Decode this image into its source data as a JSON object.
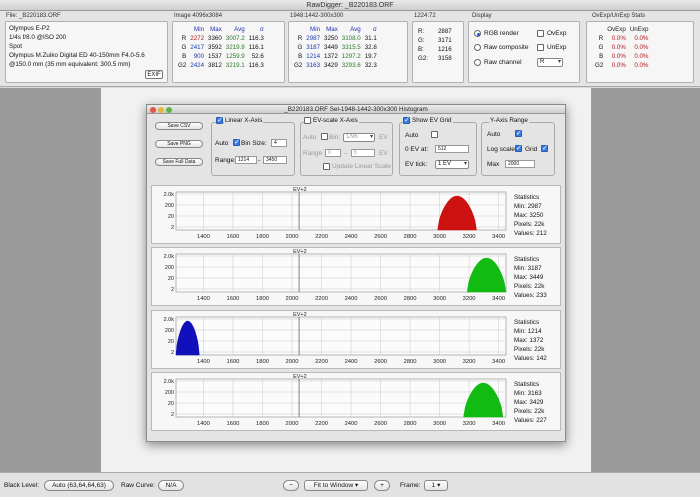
{
  "window": {
    "title": "RawDigger: _B220183.ORF"
  },
  "file_group": {
    "title": "File: _B220183.ORF",
    "lines": [
      "Olympus E-P2",
      "1/4s f/8.0 @ISO 200",
      "Spot",
      "Olympus M.Zuiko Digital ED 40-150mm F4.0-5.6",
      "@150.0 mm (35 mm equivalent: 300.5 mm)"
    ],
    "exif_label": "EXIF"
  },
  "image_group": {
    "title": "Image 4096x3084",
    "headers": [
      "Min",
      "Max",
      "Avg",
      "σ"
    ],
    "rows": [
      {
        "ch": "R",
        "min": "2272",
        "max": "3360",
        "avg": "3007.2",
        "sd": "116.3"
      },
      {
        "ch": "G",
        "min": "2417",
        "max": "3592",
        "avg": "3219.9",
        "sd": "116.1"
      },
      {
        "ch": "B",
        "min": "900",
        "max": "1537",
        "avg": "1259.9",
        "sd": "52.6"
      },
      {
        "ch": "G2",
        "min": "2424",
        "max": "3812",
        "avg": "3219.1",
        "sd": "116.3"
      }
    ]
  },
  "sel_group": {
    "title": "1948:1442-300x300",
    "headers": [
      "Min",
      "Max",
      "Avg",
      "σ"
    ],
    "rows": [
      {
        "ch": "R",
        "min": "2987",
        "max": "3250",
        "avg": "3108.0",
        "sd": "31.1"
      },
      {
        "ch": "G",
        "min": "3187",
        "max": "3449",
        "avg": "3315.5",
        "sd": "32.8"
      },
      {
        "ch": "B",
        "min": "1214",
        "max": "1372",
        "avg": "1297.2",
        "sd": "19.7"
      },
      {
        "ch": "G2",
        "min": "3163",
        "max": "3429",
        "avg": "3293.6",
        "sd": "32.3"
      }
    ]
  },
  "pixel_group": {
    "title": "1224:72",
    "rows": [
      {
        "ch": "R:",
        "val": "2887"
      },
      {
        "ch": "G:",
        "val": "3171"
      },
      {
        "ch": "B:",
        "val": "1216"
      },
      {
        "ch": "G2:",
        "val": "3158"
      }
    ]
  },
  "display_group": {
    "title": "Display",
    "rgb_render": "RGB render",
    "raw_composite": "Raw composite",
    "raw_channel": "Raw channel",
    "ovexp": "OvExp",
    "unexp": "UnExp",
    "channel_value": "R"
  },
  "ovexp_group": {
    "title": "OvExp/UnExp Stats",
    "headers": [
      "OvExp",
      "UnExp"
    ],
    "rows": [
      {
        "ch": "R",
        "ov": "0.0%",
        "un": "0.0%"
      },
      {
        "ch": "G",
        "ov": "0.0%",
        "un": "0.0%"
      },
      {
        "ch": "B",
        "ov": "0.0%",
        "un": "0.0%"
      },
      {
        "ch": "G2",
        "ov": "0.0%",
        "un": "0.0%"
      }
    ]
  },
  "hist_window": {
    "title": "_B220183.ORF Sel-1948-1442-300x300 Histogram",
    "buttons": {
      "save_csv": "Save CSV",
      "save_png": "Save PNG",
      "save_full": "Save Full Data"
    },
    "linear": {
      "title": "Linear X-Axis",
      "auto": "Auto",
      "bin_size": "Bin Size:",
      "bin_value": "4",
      "range": "Range:",
      "range_from": "1214",
      "range_to": "3450"
    },
    "evscale": {
      "title": "EV-scale X-Axis",
      "auto": "Auto",
      "bin": "Bin:",
      "bin_value": "1/96",
      "ev": "EV",
      "range": "Range",
      "range_from": "0",
      "range_to": "5",
      "update": "Update Linear Scale"
    },
    "showev": {
      "title": "Show EV Grid",
      "auto": "Auto",
      "zero_ev": "0 EV at:",
      "zero_value": "512",
      "ev_tick": "EV tick:",
      "ev_tick_value": "1 EV"
    },
    "yaxis": {
      "title": "Y-Axis Range",
      "auto": "Auto",
      "log_scale": "Log scale",
      "grid": "Grid",
      "max": "Max",
      "max_value": "2000"
    },
    "y_ticks": [
      "2.0k",
      "200",
      "20",
      "2"
    ],
    "x_ticks": [
      "1400",
      "1600",
      "1800",
      "2000",
      "2200",
      "2400",
      "2600",
      "2800",
      "3000",
      "3200",
      "3400"
    ],
    "ev_label": "EV+2",
    "stats_title": "Statistics",
    "panels": [
      {
        "color": "#cc1111",
        "min": "Min: 2987",
        "max": "Max: 3250",
        "pixels": "Pixels: 22k",
        "values": "Values: 212",
        "lo": 2987,
        "hi": 3250
      },
      {
        "color": "#11bb11",
        "min": "Min: 3187",
        "max": "Max: 3449",
        "pixels": "Pixels: 22k",
        "values": "Values: 233",
        "lo": 3187,
        "hi": 3449
      },
      {
        "color": "#1111bb",
        "min": "Min: 1214",
        "max": "Max: 1372",
        "pixels": "Pixels: 22k",
        "values": "Values: 142",
        "lo": 1214,
        "hi": 1372
      },
      {
        "color": "#11bb11",
        "min": "Min: 3163",
        "max": "Max: 3429",
        "pixels": "Pixels: 22k",
        "values": "Values: 227",
        "lo": 3163,
        "hi": 3429
      }
    ]
  },
  "chart_data": {
    "type": "area",
    "x_range": [
      1214,
      3450
    ],
    "y_scale": "log",
    "y_range": [
      1,
      2000
    ],
    "x_ticks": [
      1400,
      1600,
      1800,
      2000,
      2200,
      2400,
      2600,
      2800,
      3000,
      3200,
      3400
    ],
    "y_ticks": [
      "2",
      "20",
      "200",
      "2.0k"
    ],
    "ev_marker": {
      "label": "EV+2",
      "x": 2048
    },
    "series": [
      {
        "name": "R",
        "min": 2987,
        "max": 3250,
        "pixels": "22k",
        "values": 212
      },
      {
        "name": "G",
        "min": 3187,
        "max": 3449,
        "pixels": "22k",
        "values": 233
      },
      {
        "name": "B",
        "min": 1214,
        "max": 1372,
        "pixels": "22k",
        "values": 142
      },
      {
        "name": "G2",
        "min": 3163,
        "max": 3429,
        "pixels": "22k",
        "values": 227
      }
    ]
  },
  "statusbar": {
    "black_level_label": "Black Level:",
    "black_level_value": "Auto (63,64,64,63)",
    "raw_curve_label": "Raw Curve:",
    "raw_curve_value": "N/A",
    "zoom_minus": "−",
    "zoom_value": "Fit to Window",
    "zoom_plus": "+",
    "frame_label": "Frame:",
    "frame_value": "1"
  }
}
